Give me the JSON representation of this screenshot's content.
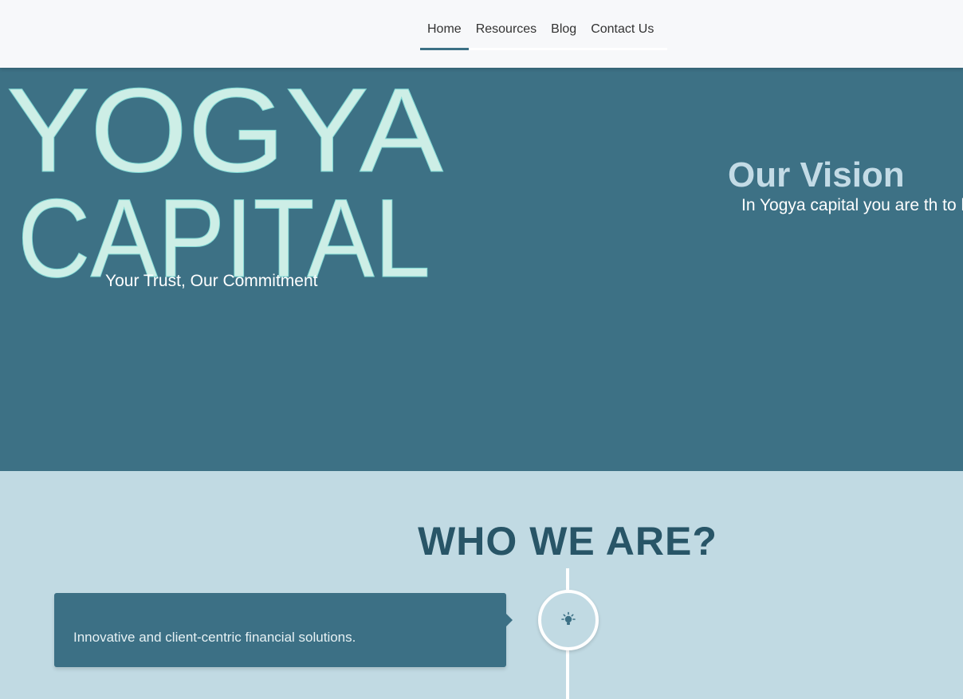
{
  "nav": {
    "items": [
      {
        "label": "Home",
        "active": true
      },
      {
        "label": "Resources"
      },
      {
        "label": "Blog"
      },
      {
        "label": "Contact Us"
      }
    ]
  },
  "hero": {
    "logo_line1": "YOGYA",
    "logo_line2": "CAPITAL",
    "tagline": "Your Trust, Our Commitment",
    "vision_title": "Our Vision",
    "vision_text": "In Yogya capital you are th to help you to find various"
  },
  "who": {
    "title": "WHO WE ARE?",
    "card_text": "Innovative and client-centric financial solutions.",
    "icon": "lightbulb-icon"
  },
  "colors": {
    "hero_bg": "#3d7185",
    "section_bg": "#c1dae3",
    "logo": "#cdeee6",
    "accent": "#3c7085",
    "title_dark": "#285567"
  }
}
